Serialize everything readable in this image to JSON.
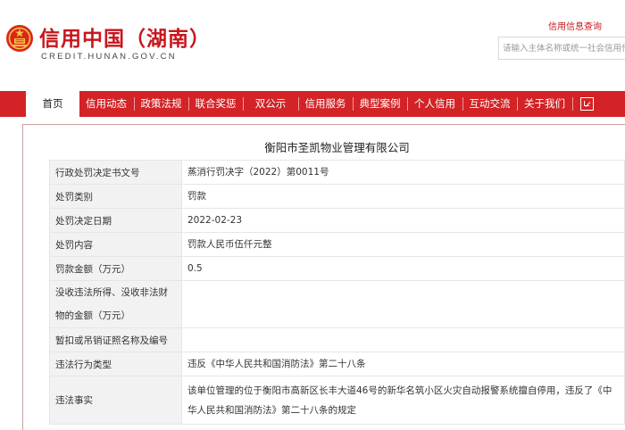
{
  "header": {
    "title": "信用中国（湖南）",
    "domain": "CREDIT.HUNAN.GOV.CN",
    "query_link": "信用信息查询",
    "search_placeholder": "请输入主体名称或统一社会信用代码"
  },
  "nav": {
    "items": [
      "首页",
      "信用动态",
      "政策法规",
      "联合奖惩",
      "双公示",
      "信用服务",
      "典型案例",
      "个人信用",
      "互动交流",
      "关于我们"
    ],
    "active": "首页"
  },
  "detail": {
    "company": "衡阳市圣凯物业管理有限公司",
    "rows": [
      {
        "label": "行政处罚决定书文号",
        "value": "蒸消行罚决字（2022）第0011号"
      },
      {
        "label": "处罚类别",
        "value": "罚款"
      },
      {
        "label": "处罚决定日期",
        "value": "2022-02-23"
      },
      {
        "label": "处罚内容",
        "value": "罚款人民币伍仟元整"
      },
      {
        "label": "罚款金额（万元）",
        "value": "0.5"
      },
      {
        "label": "没收违法所得、没收非法财物的金额（万元）",
        "value": ""
      },
      {
        "label": "暂扣或吊销证照名称及编号",
        "value": ""
      },
      {
        "label": "违法行为类型",
        "value": "违反《中华人民共和国消防法》第二十八条"
      },
      {
        "label": "违法事实",
        "value": "该单位管理的位于衡阳市高新区长丰大道46号的新华名筑小区火灾自动报警系统擅自停用，违反了《中华人民共和国消防法》第二十八条的规定"
      }
    ]
  },
  "colors": {
    "brand_red": "#d32326",
    "title_red": "#c8161d"
  }
}
